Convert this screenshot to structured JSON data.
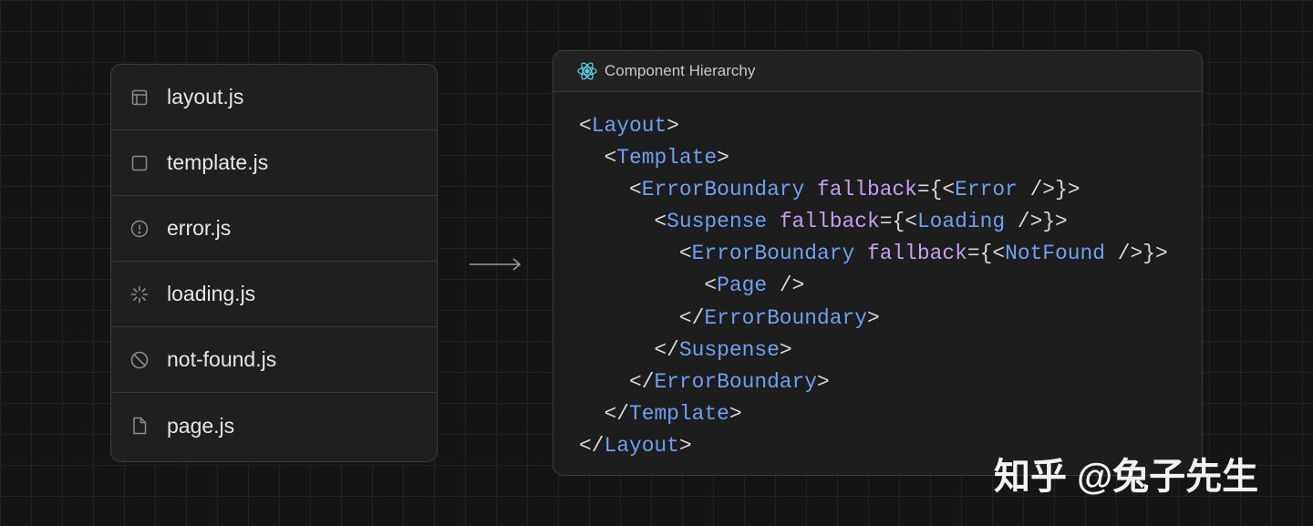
{
  "files": [
    {
      "name": "layout.js",
      "icon": "layout-icon"
    },
    {
      "name": "template.js",
      "icon": "square-icon"
    },
    {
      "name": "error.js",
      "icon": "alert-circle-icon"
    },
    {
      "name": "loading.js",
      "icon": "spinner-icon"
    },
    {
      "name": "not-found.js",
      "icon": "ban-icon"
    },
    {
      "name": "page.js",
      "icon": "file-icon"
    }
  ],
  "panel": {
    "title": "Component Hierarchy",
    "icon": "react-icon"
  },
  "code": {
    "lines": [
      {
        "indent": 0,
        "open": "<",
        "tag": "Layout",
        "attr": "",
        "mid": "",
        "fb": "",
        "close": ">"
      },
      {
        "indent": 1,
        "open": "<",
        "tag": "Template",
        "attr": "",
        "mid": "",
        "fb": "",
        "close": ">"
      },
      {
        "indent": 2,
        "open": "<",
        "tag": "ErrorBoundary",
        "attr": " fallback",
        "mid": "={<",
        "fb": "Error",
        "close": " />}>"
      },
      {
        "indent": 3,
        "open": "<",
        "tag": "Suspense",
        "attr": " fallback",
        "mid": "={<",
        "fb": "Loading",
        "close": " />}>"
      },
      {
        "indent": 4,
        "open": "<",
        "tag": "ErrorBoundary",
        "attr": " fallback",
        "mid": "={<",
        "fb": "NotFound",
        "close": " />}>"
      },
      {
        "indent": 5,
        "open": "<",
        "tag": "Page",
        "attr": "",
        "mid": "",
        "fb": "",
        "close": " />"
      },
      {
        "indent": 4,
        "open": "</",
        "tag": "ErrorBoundary",
        "attr": "",
        "mid": "",
        "fb": "",
        "close": ">"
      },
      {
        "indent": 3,
        "open": "</",
        "tag": "Suspense",
        "attr": "",
        "mid": "",
        "fb": "",
        "close": ">"
      },
      {
        "indent": 2,
        "open": "</",
        "tag": "ErrorBoundary",
        "attr": "",
        "mid": "",
        "fb": "",
        "close": ">"
      },
      {
        "indent": 1,
        "open": "</",
        "tag": "Template",
        "attr": "",
        "mid": "",
        "fb": "",
        "close": ">"
      },
      {
        "indent": 0,
        "open": "</",
        "tag": "Layout",
        "attr": "",
        "mid": "",
        "fb": "",
        "close": ">"
      }
    ]
  },
  "watermark": "知乎 @兔子先生",
  "colors": {
    "tag": "#6f9ff0",
    "attr": "#c79ef0",
    "react": "#5ccfe6"
  }
}
